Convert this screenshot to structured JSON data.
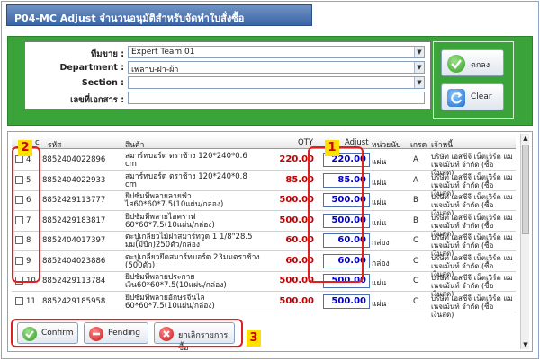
{
  "title": "P04-MC Adjust จำนวนอนุมัติสำหรับจัดทำใบสั่งซื้อ",
  "filters": {
    "team_label": "ทีมขาย :",
    "team_value": "Expert Team 01",
    "department_label": "Department :",
    "department_value": "เพลาบ-ฝา-ผ้า",
    "section_label": "Section :",
    "section_value": "",
    "docno_label": "เลขที่เอกสาร :",
    "docno_value": ""
  },
  "buttons": {
    "ok_label": "ตกลง",
    "clear_label": "Clear"
  },
  "grid": {
    "headers": {
      "no": "c",
      "code": "รหัส",
      "product": "สินค้า",
      "qty": "QTY",
      "adjust": "Adjust",
      "unit": "หน่วยนับ",
      "grade": "เกรด",
      "supplier": "เจ้าหนี้"
    },
    "rows": [
      {
        "no": "4",
        "code": "8852404022896",
        "product": "สมาร์ทบอร์ด ตราช้าง 120*240*0.6 cm",
        "qty": "220.00",
        "adjust": "220.00",
        "unit": "แผ่น",
        "grade": "A",
        "supplier": "บริษัท เอสซีจี เน็ตเวิร์ค แม เนจเม้นท์ จำกัด (ซื้อเงินสด)"
      },
      {
        "no": "5",
        "code": "8852404022933",
        "product": "สมาร์ทบอร์ด ตราช้าง 120*240*0.8 cm",
        "qty": "85.00",
        "adjust": "85.00",
        "unit": "แผ่น",
        "grade": "A",
        "supplier": "บริษัท เอสซีจี เน็ตเวิร์ค แม เนจเม้นท์ จำกัด (ซื้อเงินสด)"
      },
      {
        "no": "6",
        "code": "8852429113777",
        "product": "ยิปซัมทีพลายลายฟ้า ไส60*60*7.5(10แผ่น/กล่อง)",
        "qty": "500.00",
        "adjust": "500.00",
        "unit": "แผ่น",
        "grade": "B",
        "supplier": "บริษัท เอสซีจี เน็ตเวิร์ค แม เนจเม้นท์ จำกัด (ซื้อเงินสด)"
      },
      {
        "no": "7",
        "code": "8852429183817",
        "product": "ยิปซัมทีพลายไฮคราฟ 60*60*7.5(10แผ่น/กล่อง)",
        "qty": "500.00",
        "adjust": "500.00",
        "unit": "แผ่น",
        "grade": "B",
        "supplier": "บริษัท เอสซีจี เน็ตเวิร์ค แม เนจเม้นท์ จำกัด (ซื้อเงินสด)"
      },
      {
        "no": "8",
        "code": "8852404017397",
        "product": "ตะปูเกลียวไม้ฝาสมาร์ทวูด 1 1/8\"28.5 มม(มีปีก)250ตัว/กล่อง",
        "qty": "60.00",
        "adjust": "60.00",
        "unit": "กล่อง",
        "grade": "C",
        "supplier": "บริษัท เอสซีจี เน็ตเวิร์ค แม เนจเม้นท์ จำกัด (ซื้อเงินสด)"
      },
      {
        "no": "9",
        "code": "8852404023886",
        "product": "ตะปูเกลียวยึดสมาร์ทบอร์ด 23มมตราช้าง (500ตัว)",
        "qty": "60.00",
        "adjust": "60.00",
        "unit": "กล่อง",
        "grade": "C",
        "supplier": "บริษัท เอสซีจี เน็ตเวิร์ค แม เนจเม้นท์ จำกัด (ซื้อเงินสด)"
      },
      {
        "no": "10",
        "code": "8852429113784",
        "product": "ยิปซัมทีพลายประกาย เงิน60*60*7.5(10แผ่น/กล่อง)",
        "qty": "500.00",
        "adjust": "500.00",
        "unit": "แผ่น",
        "grade": "C",
        "supplier": "บริษัท เอสซีจี เน็ตเวิร์ค แม เนจเม้นท์ จำกัด (ซื้อเงินสด)"
      },
      {
        "no": "11",
        "code": "8852429185958",
        "product": "ยิปซัมทีพลายอักษรจีนไล 60*60*7.5(10แผ่น/กล่อง)",
        "qty": "500.00",
        "adjust": "500.00",
        "unit": "แผ่น",
        "grade": "C",
        "supplier": "บริษัท เอสซีจี เน็ตเวิร์ค แม เนจเม้นท์ จำกัด (ซื้อเงินสด)"
      }
    ]
  },
  "actions": {
    "confirm_label": "Confirm",
    "pending_label": "Pending",
    "cancel_label": "ยกเลิกรายการซื้อ"
  },
  "annotations": {
    "badge1": "1",
    "badge2": "2",
    "badge3": "3"
  },
  "colors": {
    "filter_panel": "#3aa33a",
    "qty_red": "#c00000",
    "adjust_blue": "#0000c8",
    "callout": "#e02020"
  }
}
